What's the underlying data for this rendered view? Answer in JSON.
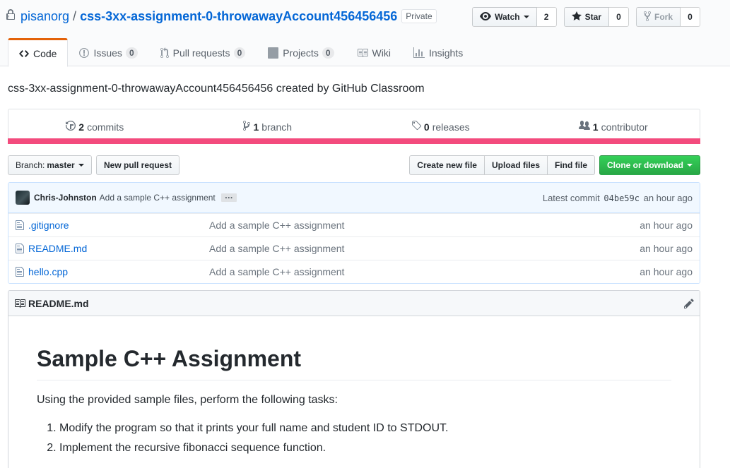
{
  "header": {
    "owner": "pisanorg",
    "separator": "/",
    "repo_name": "css-3xx-assignment-0-throwawayAccount456456456",
    "visibility": "Private",
    "watch": {
      "label": "Watch",
      "count": "2",
      "icon": "eye-icon"
    },
    "star": {
      "label": "Star",
      "count": "0",
      "icon": "star-icon"
    },
    "fork": {
      "label": "Fork",
      "count": "0",
      "icon": "fork-icon"
    }
  },
  "tabs": [
    {
      "label": "Code",
      "icon": "code-icon",
      "selected": true
    },
    {
      "label": "Issues",
      "counter": "0",
      "icon": "issue-icon"
    },
    {
      "label": "Pull requests",
      "counter": "0",
      "icon": "pull-request-icon"
    },
    {
      "label": "Projects",
      "counter": "0",
      "icon": "project-icon"
    },
    {
      "label": "Wiki",
      "icon": "book-icon"
    },
    {
      "label": "Insights",
      "icon": "graph-icon"
    }
  ],
  "description": "css-3xx-assignment-0-throwawayAccount456456456 created by GitHub Classroom",
  "summary": {
    "commits": {
      "count": "2",
      "label": "commits"
    },
    "branches": {
      "count": "1",
      "label": "branch"
    },
    "releases": {
      "count": "0",
      "label": "releases"
    },
    "contributors": {
      "count": "1",
      "label": "contributor"
    },
    "language_color": "#f34b7d"
  },
  "file_nav": {
    "branch_prefix": "Branch:",
    "branch_name": "master",
    "new_pull_request": "New pull request",
    "create_new_file": "Create new file",
    "upload_files": "Upload files",
    "find_file": "Find file",
    "clone_or_download": "Clone or download"
  },
  "latest_commit": {
    "author": "Chris-Johnston",
    "message": "Add a sample C++ assignment",
    "ellipsis": "…",
    "prefix": "Latest commit",
    "sha": "04be59c",
    "age": "an hour ago"
  },
  "files": [
    {
      "name": ".gitignore",
      "message": "Add a sample C++ assignment",
      "age": "an hour ago"
    },
    {
      "name": "README.md",
      "message": "Add a sample C++ assignment",
      "age": "an hour ago"
    },
    {
      "name": "hello.cpp",
      "message": "Add a sample C++ assignment",
      "age": "an hour ago"
    }
  ],
  "readme": {
    "filename": "README.md",
    "heading": "Sample C++ Assignment",
    "intro": "Using the provided sample files, perform the following tasks:",
    "tasks": [
      "Modify the program so that it prints your full name and student ID to STDOUT.",
      "Implement the recursive fibonacci sequence function."
    ]
  }
}
